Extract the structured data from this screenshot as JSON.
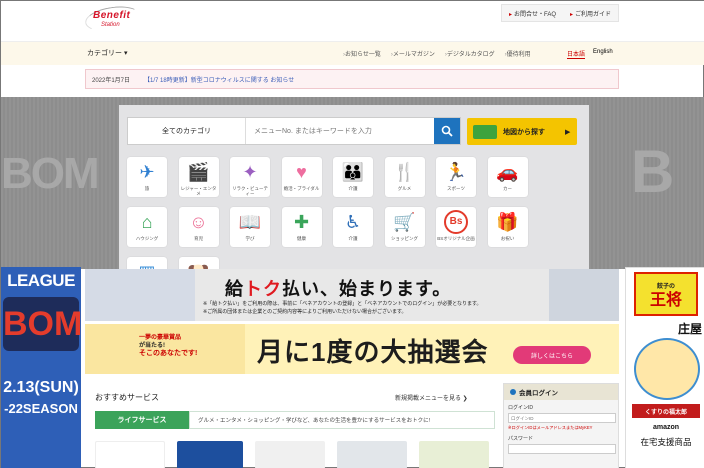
{
  "logo": {
    "word": "Benefit",
    "sub": "Station"
  },
  "header": {
    "links": [
      "お問合せ・FAQ",
      "ご利用ガイド"
    ]
  },
  "nav": {
    "category": "カテゴリー ▾",
    "links": [
      "お知らせ一覧",
      "メールマガジン",
      "デジタルカタログ",
      "優待利用"
    ],
    "lang": [
      "日本語",
      "English"
    ]
  },
  "notice": {
    "date": "2022年1月7日",
    "text": "【1/7 18時更新】新型コロナウィルスに関する お知らせ"
  },
  "search": {
    "category": "全てのカテゴリ",
    "placeholder": "メニューNo. またはキーワードを入力",
    "map_label": "地図から探す"
  },
  "categories": [
    {
      "label": "旅",
      "icon": "airplane-icon",
      "color": "#2f7fd1",
      "glyph": "✈"
    },
    {
      "label": "レジャー・エンタメ",
      "icon": "film-icon",
      "color": "#e8842a",
      "glyph": "🎬"
    },
    {
      "label": "リラク・ビューティー",
      "icon": "sparkle-icon",
      "color": "#9b5fc0",
      "glyph": "✦"
    },
    {
      "label": "婚活・ブライダル",
      "icon": "hearts-icon",
      "color": "#ee6e9f",
      "glyph": "♥"
    },
    {
      "label": "介護",
      "icon": "family-icon",
      "color": "#b78a3a",
      "glyph": "👪"
    },
    {
      "label": "グルメ",
      "icon": "cutlery-icon",
      "color": "#d23a3a",
      "glyph": "🍴"
    },
    {
      "label": "スポーツ",
      "icon": "runner-icon",
      "color": "#2b8fd6",
      "glyph": "🏃"
    },
    {
      "label": "カー",
      "icon": "car-icon",
      "color": "#3a6fb0",
      "glyph": "🚗"
    },
    {
      "label": "ハウジング",
      "icon": "house-icon",
      "color": "#3aa55a",
      "glyph": "⌂"
    },
    {
      "label": "育児",
      "icon": "baby-icon",
      "color": "#ec6f96",
      "glyph": "☺"
    },
    {
      "label": "学び",
      "icon": "book-icon",
      "color": "#2f7fd1",
      "glyph": "📖"
    },
    {
      "label": "健康",
      "icon": "cross-icon",
      "color": "#3aa55a",
      "glyph": "✚"
    },
    {
      "label": "介護",
      "icon": "wheelchair-icon",
      "color": "#2f6fb8",
      "glyph": "♿"
    },
    {
      "label": "ショッピング",
      "icon": "cart-icon",
      "color": "#f2a12a",
      "glyph": "🛒"
    },
    {
      "label": "BSオリジナル企画",
      "icon": "bs-icon",
      "color": "#e33a2a",
      "glyph": "Bs"
    },
    {
      "label": "お祝い",
      "icon": "gift-icon",
      "color": "#d82a2a",
      "glyph": "🎁"
    },
    {
      "label": "エネルギー",
      "icon": "solar-icon",
      "color": "#3a8fd8",
      "glyph": "▦"
    },
    {
      "label": "ペット",
      "icon": "dog-icon",
      "color": "#e8a35a",
      "glyph": "🐶"
    }
  ],
  "banner1": {
    "headline_a": "給",
    "headline_b": "トク",
    "headline_c": "払い、始まります。",
    "note1": "※「給トク払い」をご利用の際は、事前に「ベネアカウントの登録」と「ベネアカウントでのログイン」が必要となります。",
    "note2": "※ご所属の団体または企業とのご契約内容等によりご利用いただけない場合がございます。"
  },
  "banner2": {
    "l1": "一夢の豪華賞品",
    "l2": "が当たる!",
    "l3": "そこのあなたです!",
    "headline": "月に1度の大抽選会",
    "button": "詳しくはこちら"
  },
  "leftad": {
    "league": "LEAGUE",
    "logo": "BOM",
    "date": "2.13(SUN)",
    "season": "-22SEASON"
  },
  "rightad": {
    "gyoza": "王将",
    "gyoza_small": "餃子の",
    "shoya": "庄屋",
    "sign": "くすりの福太郎",
    "amazon": "amazon",
    "text": "在宅支援商品"
  },
  "recommend": {
    "title": "おすすめサービス",
    "new_link": "新規掲載メニューを見る ❯",
    "tab": "ライフサービス",
    "desc": "グルメ・エンタメ・ショッピング・学びなど、あなたの生活を豊かにするサービスをおトクに!"
  },
  "login": {
    "title": "会員ログイン",
    "id_label": "ログインID",
    "id_placeholder": "ログインID",
    "note": "※ログインIDはメールアドレスまたはMyKEY",
    "pw_label": "パスワード"
  }
}
